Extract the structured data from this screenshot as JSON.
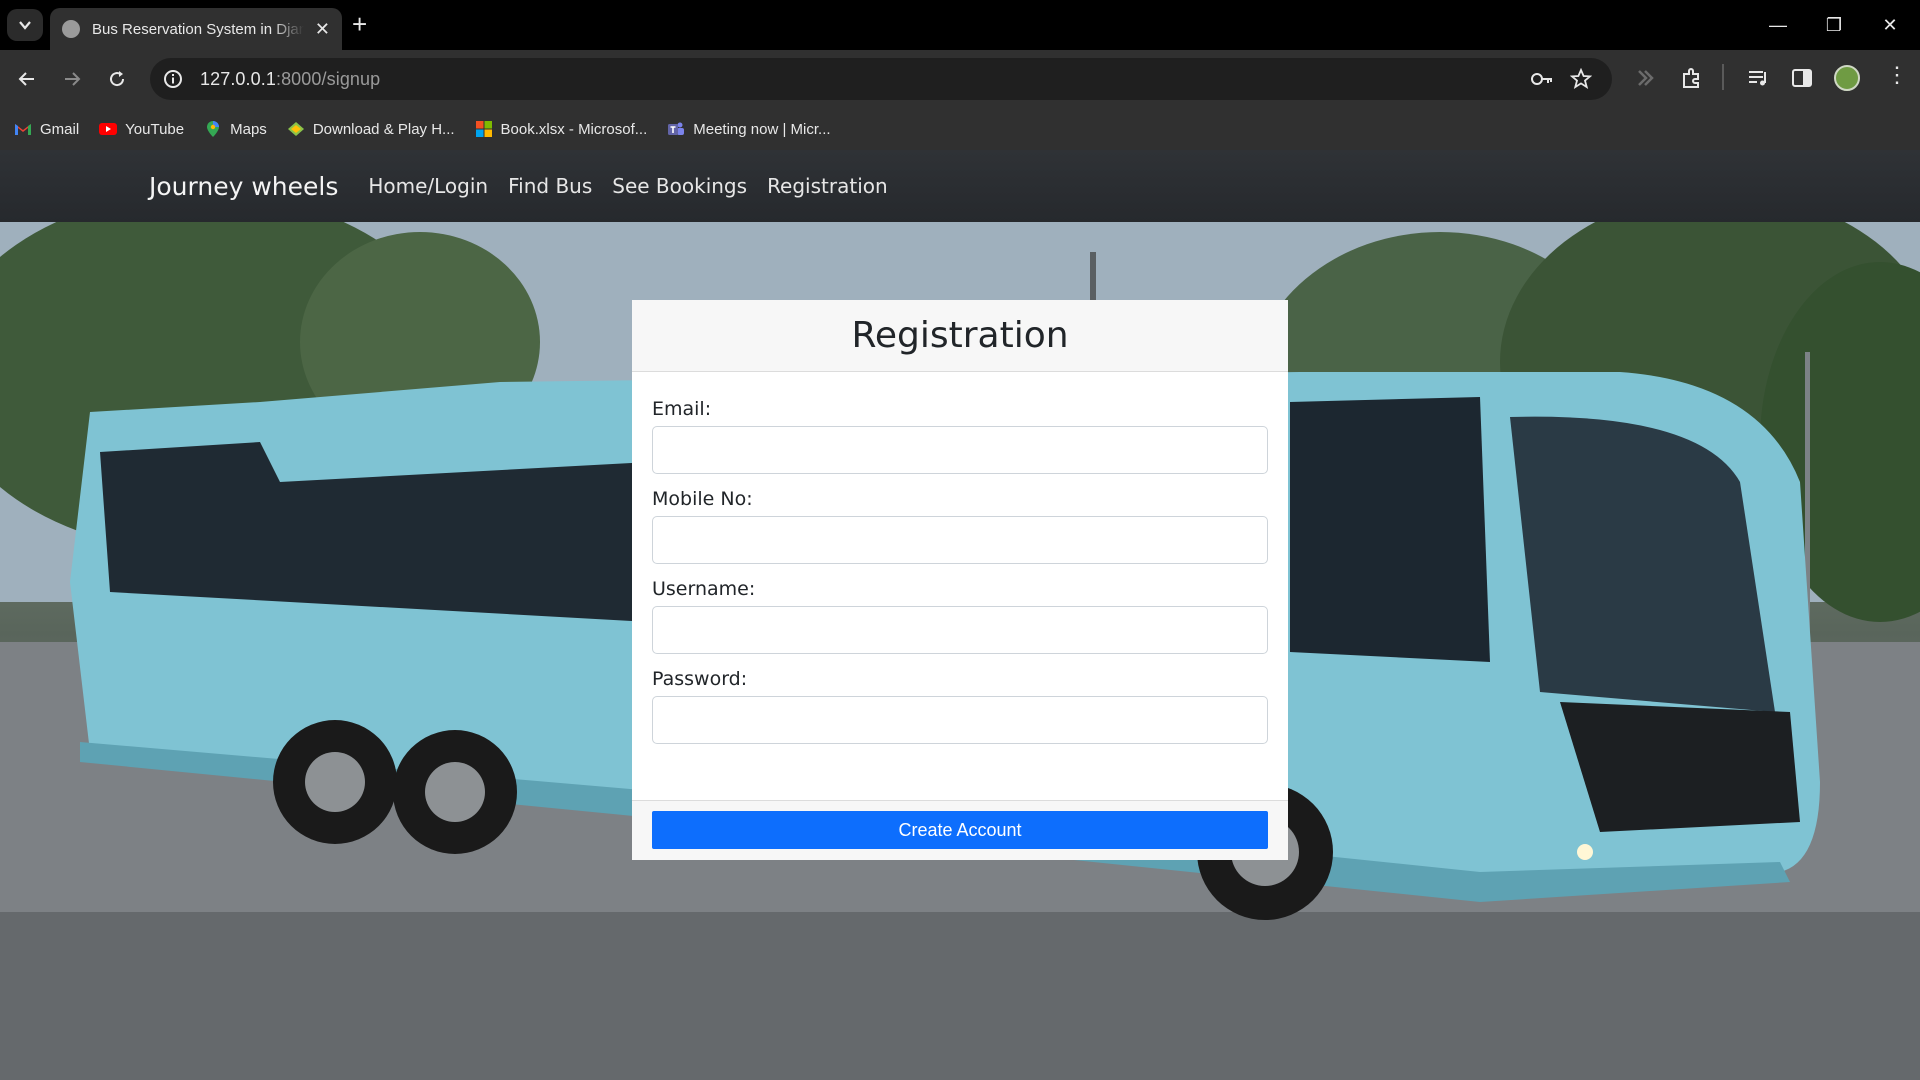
{
  "browser": {
    "tab_title": "Bus Reservation System in Django",
    "url_host": "127.0.0.1",
    "url_rest": ":8000/signup",
    "bookmarks": [
      {
        "label": "Gmail",
        "color": "#ea4335"
      },
      {
        "label": "YouTube",
        "color": "#ff0000"
      },
      {
        "label": "Maps",
        "color": "#34a853"
      },
      {
        "label": "Download & Play H...",
        "color": "#8bc34a"
      },
      {
        "label": "Book.xlsx - Microsof...",
        "color": "#f25022"
      },
      {
        "label": "Meeting now | Micr...",
        "color": "#6264a7"
      }
    ]
  },
  "site": {
    "brand": "Journey wheels",
    "nav": [
      "Home/Login",
      "Find Bus",
      "See Bookings",
      "Registration"
    ]
  },
  "form": {
    "title": "Registration",
    "fields": [
      {
        "label": "Email:",
        "value": ""
      },
      {
        "label": "Mobile No:",
        "value": ""
      },
      {
        "label": "Username:",
        "value": ""
      },
      {
        "label": "Password:",
        "value": ""
      }
    ],
    "submit_label": "Create Account"
  },
  "colors": {
    "primary_button": "#0d6efd",
    "navbar": "#2b2e32",
    "bus_body": "#7fc3d3"
  }
}
